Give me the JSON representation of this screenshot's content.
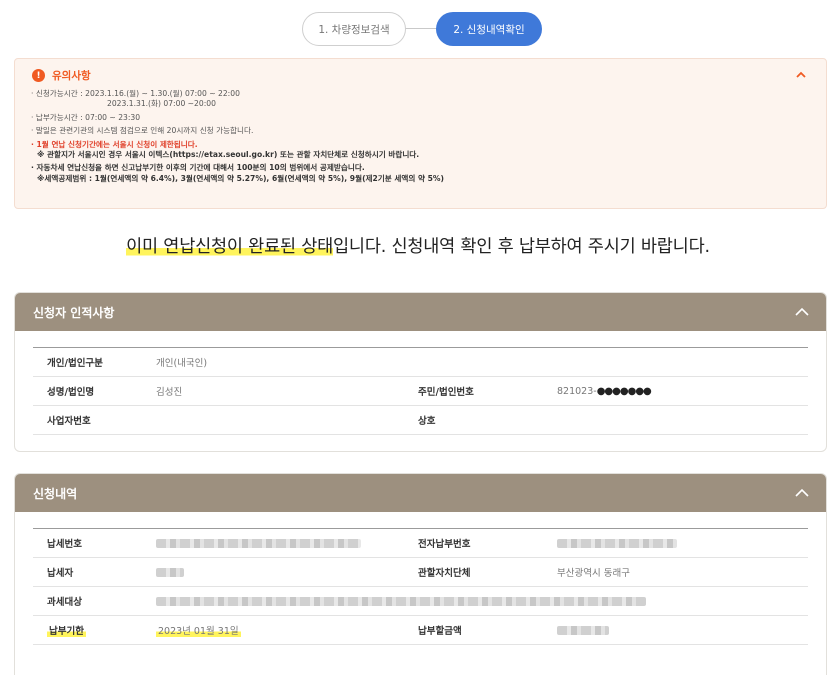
{
  "stepper": {
    "steps": [
      "1. 차량정보검색",
      "2. 신청내역확인"
    ]
  },
  "notice": {
    "title": "유의사항",
    "lines": [
      "· 신청가능시간 : 2023.1.16.(월) ~ 1.30.(월) 07:00 ~ 22:00",
      "2023.1.31.(화) 07:00 ~20:00",
      "· 납부가능시간 : 07:00 ~ 23:30",
      "· 말일은 관련기관의 시스템 점검으로 인해 20시까지 신청 가능합니다.",
      "· 1월 연납 신청기간에는 서울시 신청이 제한됩니다.",
      "※ 관할지가 서울시인 경우 서울시 이텍스(https://etax.seoul.go.kr) 또는 관할 자치단체로 신청하시기 바랍니다.",
      "· 자동차세 연납신청을 하면 신고납부기한 이후의 기간에 대해서 100분의 10의 범위에서 공제받습니다.",
      "※세액공제범위 : 1월(연세액의 약 6.4%), 3월(연세액의 약 5.27%), 6월(연세액의 약 5%), 9월(제2기분 세액의 약 5%)"
    ]
  },
  "status": {
    "highlighted": "이미 연납신청이 완료된 상태",
    "rest": "입니다. 신청내역 확인 후 납부하여 주시기 바랍니다."
  },
  "applicant": {
    "title": "신청자 인적사항",
    "type_label": "개인/법인구분",
    "type_value": "개인(내국인)",
    "name_label": "성명/법인명",
    "name_value": "김성진",
    "id_label": "주민/법인번호",
    "id_prefix": "821023-",
    "id_mask": "●●●●●●●",
    "biz_label": "사업자번호",
    "biz_value": "",
    "company_label": "상호",
    "company_value": ""
  },
  "details": {
    "title": "신청내역",
    "tax_no_label": "납세번호",
    "epay_label": "전자납부번호",
    "payer_label": "납세자",
    "authority_label": "관할자치단체",
    "authority_value": "부산광역시 동래구",
    "object_label": "과세대상",
    "due_label": "납부기한",
    "due_value": "2023년 01월 31일",
    "amount_label": "납부할금액"
  },
  "colors": {
    "accent": "#3f79d9",
    "warning": "#f05a22",
    "panel_header": "#9d907f",
    "highlight": "#fff45c"
  }
}
